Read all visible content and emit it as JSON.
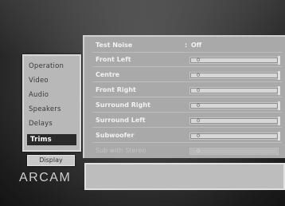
{
  "menu": {
    "items": [
      {
        "label": "Operation"
      },
      {
        "label": "Video"
      },
      {
        "label": "Audio"
      },
      {
        "label": "Speakers"
      },
      {
        "label": "Delays"
      },
      {
        "label": "Trims"
      }
    ],
    "selected": "Trims"
  },
  "tabs": {
    "display_label": "Display"
  },
  "brand": {
    "logo_text": "ARCAM"
  },
  "trims": {
    "test_noise": {
      "label": "Test Noise",
      "value": "Off"
    },
    "rows": [
      {
        "label": "Front Left",
        "value": "0"
      },
      {
        "label": "Centre",
        "value": "0"
      },
      {
        "label": "Front Right",
        "value": "0"
      },
      {
        "label": "Surround Right",
        "value": "0"
      },
      {
        "label": "Surround Left",
        "value": "0"
      },
      {
        "label": "Subwoofer",
        "value": "0"
      },
      {
        "label": "Sub with Stereo",
        "value": "0"
      }
    ]
  },
  "colors": {
    "selected_bg": "#2a2a2a",
    "panel_bg": "#a9a9a9"
  }
}
